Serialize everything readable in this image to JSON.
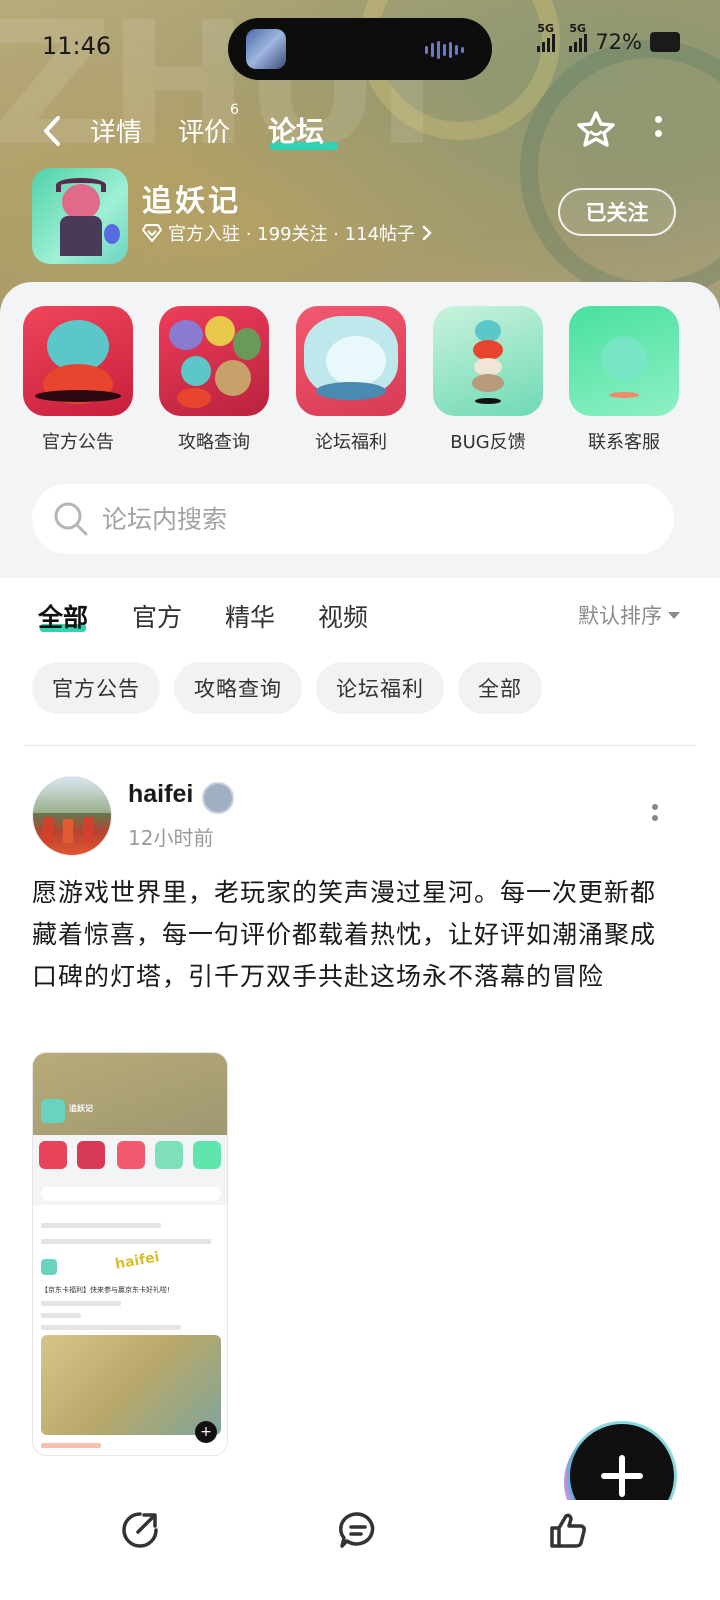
{
  "status": {
    "time": "11:46",
    "signal1": "5G",
    "signal2": "5G",
    "battery": "72%"
  },
  "nav": {
    "tabs": [
      {
        "label": "详情"
      },
      {
        "label": "评价",
        "badge": "6"
      },
      {
        "label": "论坛"
      }
    ],
    "active_tab": "论坛"
  },
  "game": {
    "title": "追妖记",
    "meta": "官方入驻 · 199关注 · 114帖子",
    "follow_label": "已关注"
  },
  "shortcuts": [
    {
      "label": "官方公告"
    },
    {
      "label": "攻略查询"
    },
    {
      "label": "论坛福利"
    },
    {
      "label": "BUG反馈"
    },
    {
      "label": "联系客服"
    }
  ],
  "search": {
    "placeholder": "论坛内搜索"
  },
  "filter_tabs": [
    {
      "label": "全部"
    },
    {
      "label": "官方"
    },
    {
      "label": "精华"
    },
    {
      "label": "视频"
    }
  ],
  "sort_label": "默认排序",
  "chips": [
    {
      "label": "官方公告"
    },
    {
      "label": "攻略查询"
    },
    {
      "label": "论坛福利"
    },
    {
      "label": "全部"
    }
  ],
  "post": {
    "username": "haifei",
    "time": "12小时前",
    "body": "愿游戏世界里，老玩家的笑声漫过星河。每一次更新都藏着惊喜，每一句评价都载着热忱，让好评如潮涌聚成口碑的灯塔，引千万双手共赴这场永不落幕的冒险",
    "screenshot": {
      "title": "追妖记",
      "announce": "【京东卡福利】快来参与赢京东卡好礼啦!",
      "watermark": "haifei"
    }
  },
  "colors": {
    "accent": "#2fd3b3",
    "hero_bg": "#a89b6c",
    "panel_bg": "#f3f4f6"
  }
}
